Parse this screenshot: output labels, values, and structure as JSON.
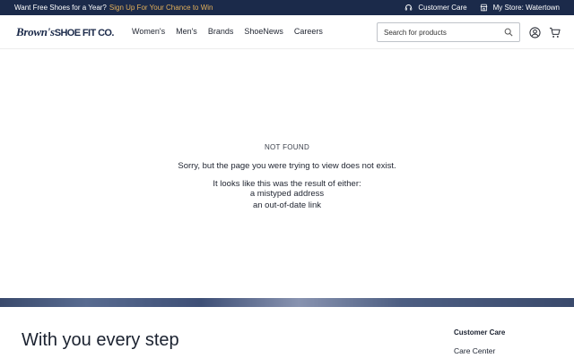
{
  "topbar": {
    "promo_text": "Want Free Shoes for a Year?",
    "promo_link": "Sign Up For Your Chance to Win",
    "customer_care": "Customer Care",
    "my_store": "My Store: Watertown"
  },
  "header": {
    "logo_script": "Brown's",
    "logo_caps": "SHOE FIT CO.",
    "nav": [
      "Women's",
      "Men's",
      "Brands",
      "ShoeNews",
      "Careers"
    ],
    "search_placeholder": "Search for products"
  },
  "not_found": {
    "title": "NOT FOUND",
    "message": "Sorry, but the page you were trying to view does not exist.",
    "intro": "It looks like this was the result of either:",
    "reasons": [
      "a mistyped address",
      "an out-of-date link"
    ]
  },
  "footer": {
    "tagline": "With you every step",
    "section_heading": "Customer Care",
    "links": [
      "Care Center"
    ]
  },
  "colors": {
    "navy": "#1b2a4a",
    "promo_accent": "#e3b05a"
  }
}
